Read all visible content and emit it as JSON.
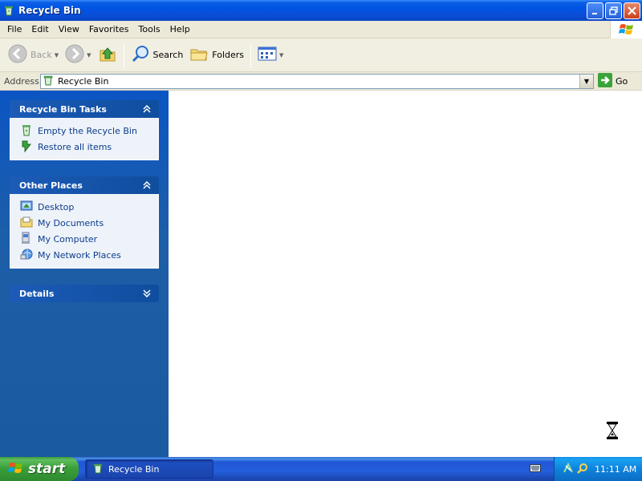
{
  "window": {
    "title": "Recycle Bin",
    "icon": "recycle-bin-icon"
  },
  "menu": [
    "File",
    "Edit",
    "View",
    "Favorites",
    "Tools",
    "Help"
  ],
  "toolbar": {
    "back_label": "Back",
    "search_label": "Search",
    "folders_label": "Folders"
  },
  "address": {
    "label": "Address",
    "value": "Recycle Bin",
    "go_label": "Go"
  },
  "taskpane": {
    "tasks": {
      "title": "Recycle Bin Tasks",
      "items": [
        "Empty the Recycle Bin",
        "Restore all items"
      ]
    },
    "places": {
      "title": "Other Places",
      "items": [
        "Desktop",
        "My Documents",
        "My Computer",
        "My Network Places"
      ]
    },
    "details": {
      "title": "Details"
    }
  },
  "taskbar": {
    "start_label": "start",
    "active_window": "Recycle Bin",
    "clock": "11:11 AM"
  },
  "colors": {
    "titlebar": "#0054e3",
    "taskpane": "#1d5ea8",
    "link": "#0c3c8c",
    "start": "#3aa03a"
  }
}
